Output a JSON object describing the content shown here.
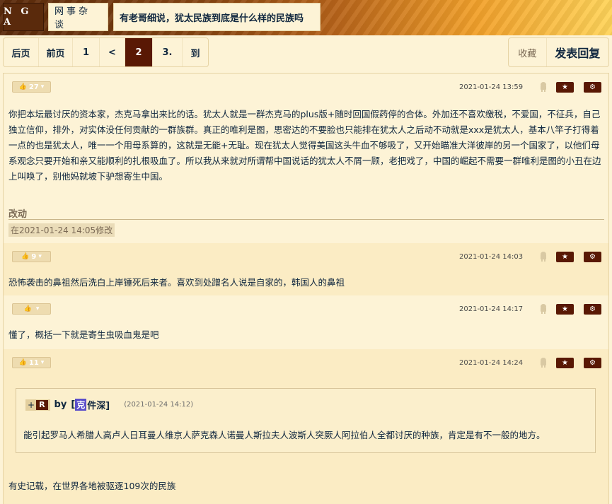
{
  "nav": {
    "logo": "N G A",
    "category": "网事杂谈",
    "topic": "有老哥细说，犹太民族到底是什么样的民族吗"
  },
  "pager": {
    "first": "后页",
    "prev": "前页",
    "p1": "1",
    "lt": "<",
    "current": "2",
    "p3": "3.",
    "goto": "到"
  },
  "actions": {
    "favorite": "收藏",
    "reply": "发表回复"
  },
  "colors": {
    "accent": "#591804",
    "background": "#fdf3d6",
    "alt_row": "#fbecc4"
  },
  "icons": {
    "like": "thumb-up-icon",
    "dislike": "thumb-down-icon",
    "device": "android-icon",
    "fav": "star-icon",
    "settings": "gear-icon"
  },
  "posts": [
    {
      "likes": "27",
      "time": "2021-01-24 13:59",
      "content": "你把本坛最讨厌的资本家，杰克马拿出来比的话。犹太人就是一群杰克马的plus版+随时回国假药停的合体。外加还不喜欢缴税，不爱国，不征兵，自己独立信仰，排外，对实体没任何贡献的一群族群。真正的唯利是图，思密达的不要脸也只能排在犹太人之后动不动就是xxx是犹太人，基本八竿子打得着一点的也是犹太人，唯一一个用母系算的，这就是无能+无耻。现在犹太人觉得美国这头牛血不够吸了，又开始瞄准大洋彼岸的另一个国家了，以他们母系观念只要开始和亲又能顺利的扎根吸血了。所以我从来就对所谓帮中国说话的犹太人不屑一顾，老把戏了，中国的崛起不需要一群唯利是图的小丑在边上叫唤了，别他妈就坡下驴想寄生中国。",
      "edit_title": "改动",
      "edit_note": "在2021-01-24 14:05修改"
    },
    {
      "likes": "9",
      "time": "2021-01-24 14:03",
      "content": "恐怖袭击的鼻祖然后洗白上岸锤死后来者。喜欢到处蹭名人说是自家的，韩国人的鼻祖"
    },
    {
      "likes": "",
      "time": "2021-01-24 14:17",
      "content": "懂了，概括一下就是寄生虫吸血鬼是吧"
    },
    {
      "likes": "11",
      "time": "2021-01-24 14:24",
      "quote": {
        "plus": "+",
        "r": "R",
        "by": "by",
        "bracket_open": "[",
        "badge": "克",
        "name": "件深]",
        "time": "(2021-01-24 14:12)",
        "text": "能引起罗马人希腊人高卢人日耳曼人维京人萨克森人诺曼人斯拉夫人波斯人突厥人阿拉伯人全都讨厌的种族，肯定是有不一般的地方。"
      },
      "content": "有史记载，在世界各地被驱逐109次的民族"
    }
  ]
}
